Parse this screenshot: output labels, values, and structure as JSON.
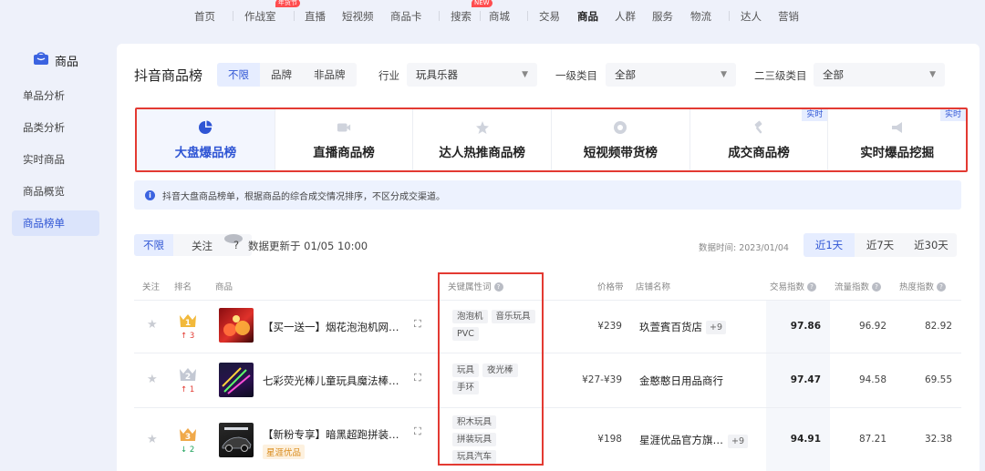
{
  "nav": {
    "items": [
      "首页",
      "作战室",
      "直播",
      "短视频",
      "商品卡",
      "搜索",
      "商城",
      "交易",
      "商品",
      "人群",
      "服务",
      "物流",
      "达人",
      "营销"
    ],
    "active": "商品",
    "badges": {
      "zuozhanshi": "年货节",
      "shangcheng": "NEW"
    }
  },
  "sidebar": {
    "title": "商品",
    "items": [
      "单品分析",
      "品类分析",
      "实时商品",
      "商品概览",
      "商品榜单"
    ],
    "active": "商品榜单"
  },
  "header": {
    "title": "抖音商品榜",
    "brand_filter": [
      "不限",
      "品牌",
      "非品牌"
    ],
    "industry_label": "行业",
    "industry_value": "玩具乐器",
    "cat1_label": "一级类目",
    "cat1_value": "全部",
    "cat23_label": "二三级类目",
    "cat23_value": "全部"
  },
  "tabs": [
    {
      "label": "大盘爆品榜",
      "icon": "pie-icon",
      "badge": ""
    },
    {
      "label": "直播商品榜",
      "icon": "video-icon",
      "badge": ""
    },
    {
      "label": "达人热推商品榜",
      "icon": "star-badge-icon",
      "badge": ""
    },
    {
      "label": "短视频带货榜",
      "icon": "play-circle-icon",
      "badge": ""
    },
    {
      "label": "成交商品榜",
      "icon": "gavel-icon",
      "badge": "实时"
    },
    {
      "label": "实时爆品挖掘",
      "icon": "megaphone-icon",
      "badge": "实时"
    }
  ],
  "info": "抖音大盘商品榜单，根据商品的综合成交情况排序，不区分成交渠道。",
  "toolbar": {
    "filter": [
      "不限",
      "关注"
    ],
    "updated": "数据更新于 01/05 10:00",
    "data_time": "数据时间: 2023/01/04",
    "ranges": [
      "近1天",
      "近7天",
      "近30天"
    ]
  },
  "columns": {
    "follow": "关注",
    "rank": "排名",
    "product": "商品",
    "keywords": "关键属性词",
    "price": "价格带",
    "shop": "店铺名称",
    "trade": "交易指数",
    "traffic": "流量指数",
    "heat": "热度指数"
  },
  "rows": [
    {
      "rank": "1",
      "change": "↑ 3",
      "name": "【买一送一】烟花泡泡机网红玩具",
      "tag": "",
      "keywords": [
        "泡泡机",
        "音乐玩具",
        "PVC"
      ],
      "price": "¥239",
      "shop": "玖萱賓百货店",
      "shop_more": "+9",
      "trade": "97.86",
      "traffic": "96.92",
      "heat": "82.92"
    },
    {
      "rank": "2",
      "change": "↑ 1",
      "name": "七彩荧光棒儿童玩具魔法棒夜光手环",
      "tag": "",
      "keywords": [
        "玩具",
        "夜光棒",
        "手环"
      ],
      "price": "¥27-¥39",
      "shop": "金憨憨日用品商行",
      "shop_more": "",
      "trade": "97.47",
      "traffic": "94.58",
      "heat": "69.55"
    },
    {
      "rank": "3",
      "change": "↓ 2",
      "name": "【新粉专享】暗黑超跑拼装积木汽车",
      "tag": "星涯优品",
      "keywords": [
        "积木玩具",
        "拼装玩具",
        "玩具汽车"
      ],
      "price": "¥198",
      "shop": "星涯优品官方旗舰店",
      "shop_more": "+9",
      "trade": "94.91",
      "traffic": "87.21",
      "heat": "32.38"
    }
  ]
}
